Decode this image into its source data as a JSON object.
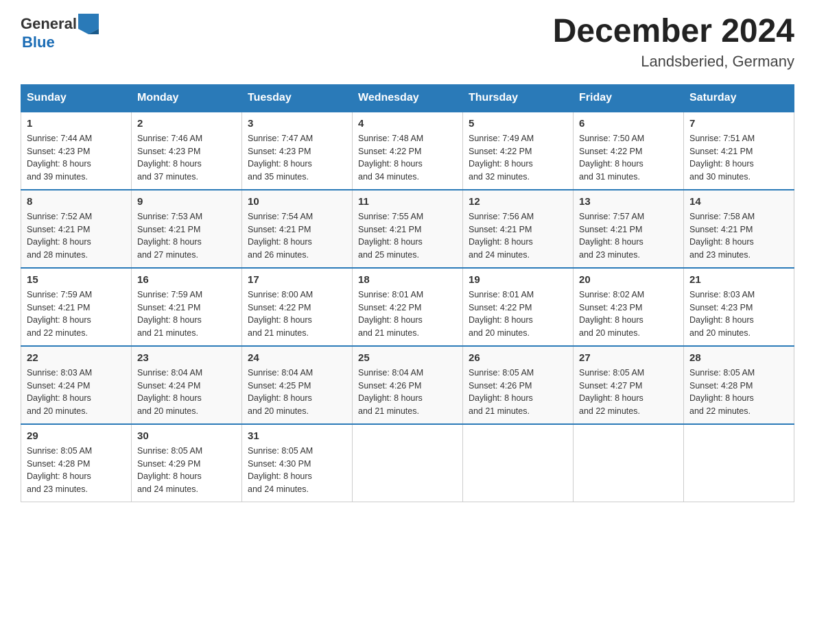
{
  "header": {
    "logo_general": "General",
    "logo_blue": "Blue",
    "title": "December 2024",
    "location": "Landsberied, Germany"
  },
  "days_of_week": [
    "Sunday",
    "Monday",
    "Tuesday",
    "Wednesday",
    "Thursday",
    "Friday",
    "Saturday"
  ],
  "weeks": [
    {
      "days": [
        {
          "num": "1",
          "sunrise": "7:44 AM",
          "sunset": "4:23 PM",
          "daylight": "8 hours and 39 minutes."
        },
        {
          "num": "2",
          "sunrise": "7:46 AM",
          "sunset": "4:23 PM",
          "daylight": "8 hours and 37 minutes."
        },
        {
          "num": "3",
          "sunrise": "7:47 AM",
          "sunset": "4:23 PM",
          "daylight": "8 hours and 35 minutes."
        },
        {
          "num": "4",
          "sunrise": "7:48 AM",
          "sunset": "4:22 PM",
          "daylight": "8 hours and 34 minutes."
        },
        {
          "num": "5",
          "sunrise": "7:49 AM",
          "sunset": "4:22 PM",
          "daylight": "8 hours and 32 minutes."
        },
        {
          "num": "6",
          "sunrise": "7:50 AM",
          "sunset": "4:22 PM",
          "daylight": "8 hours and 31 minutes."
        },
        {
          "num": "7",
          "sunrise": "7:51 AM",
          "sunset": "4:21 PM",
          "daylight": "8 hours and 30 minutes."
        }
      ]
    },
    {
      "days": [
        {
          "num": "8",
          "sunrise": "7:52 AM",
          "sunset": "4:21 PM",
          "daylight": "8 hours and 28 minutes."
        },
        {
          "num": "9",
          "sunrise": "7:53 AM",
          "sunset": "4:21 PM",
          "daylight": "8 hours and 27 minutes."
        },
        {
          "num": "10",
          "sunrise": "7:54 AM",
          "sunset": "4:21 PM",
          "daylight": "8 hours and 26 minutes."
        },
        {
          "num": "11",
          "sunrise": "7:55 AM",
          "sunset": "4:21 PM",
          "daylight": "8 hours and 25 minutes."
        },
        {
          "num": "12",
          "sunrise": "7:56 AM",
          "sunset": "4:21 PM",
          "daylight": "8 hours and 24 minutes."
        },
        {
          "num": "13",
          "sunrise": "7:57 AM",
          "sunset": "4:21 PM",
          "daylight": "8 hours and 23 minutes."
        },
        {
          "num": "14",
          "sunrise": "7:58 AM",
          "sunset": "4:21 PM",
          "daylight": "8 hours and 23 minutes."
        }
      ]
    },
    {
      "days": [
        {
          "num": "15",
          "sunrise": "7:59 AM",
          "sunset": "4:21 PM",
          "daylight": "8 hours and 22 minutes."
        },
        {
          "num": "16",
          "sunrise": "7:59 AM",
          "sunset": "4:21 PM",
          "daylight": "8 hours and 21 minutes."
        },
        {
          "num": "17",
          "sunrise": "8:00 AM",
          "sunset": "4:22 PM",
          "daylight": "8 hours and 21 minutes."
        },
        {
          "num": "18",
          "sunrise": "8:01 AM",
          "sunset": "4:22 PM",
          "daylight": "8 hours and 21 minutes."
        },
        {
          "num": "19",
          "sunrise": "8:01 AM",
          "sunset": "4:22 PM",
          "daylight": "8 hours and 20 minutes."
        },
        {
          "num": "20",
          "sunrise": "8:02 AM",
          "sunset": "4:23 PM",
          "daylight": "8 hours and 20 minutes."
        },
        {
          "num": "21",
          "sunrise": "8:03 AM",
          "sunset": "4:23 PM",
          "daylight": "8 hours and 20 minutes."
        }
      ]
    },
    {
      "days": [
        {
          "num": "22",
          "sunrise": "8:03 AM",
          "sunset": "4:24 PM",
          "daylight": "8 hours and 20 minutes."
        },
        {
          "num": "23",
          "sunrise": "8:04 AM",
          "sunset": "4:24 PM",
          "daylight": "8 hours and 20 minutes."
        },
        {
          "num": "24",
          "sunrise": "8:04 AM",
          "sunset": "4:25 PM",
          "daylight": "8 hours and 20 minutes."
        },
        {
          "num": "25",
          "sunrise": "8:04 AM",
          "sunset": "4:26 PM",
          "daylight": "8 hours and 21 minutes."
        },
        {
          "num": "26",
          "sunrise": "8:05 AM",
          "sunset": "4:26 PM",
          "daylight": "8 hours and 21 minutes."
        },
        {
          "num": "27",
          "sunrise": "8:05 AM",
          "sunset": "4:27 PM",
          "daylight": "8 hours and 22 minutes."
        },
        {
          "num": "28",
          "sunrise": "8:05 AM",
          "sunset": "4:28 PM",
          "daylight": "8 hours and 22 minutes."
        }
      ]
    },
    {
      "days": [
        {
          "num": "29",
          "sunrise": "8:05 AM",
          "sunset": "4:28 PM",
          "daylight": "8 hours and 23 minutes."
        },
        {
          "num": "30",
          "sunrise": "8:05 AM",
          "sunset": "4:29 PM",
          "daylight": "8 hours and 24 minutes."
        },
        {
          "num": "31",
          "sunrise": "8:05 AM",
          "sunset": "4:30 PM",
          "daylight": "8 hours and 24 minutes."
        },
        null,
        null,
        null,
        null
      ]
    }
  ],
  "labels": {
    "sunrise": "Sunrise:",
    "sunset": "Sunset:",
    "daylight": "Daylight:"
  }
}
